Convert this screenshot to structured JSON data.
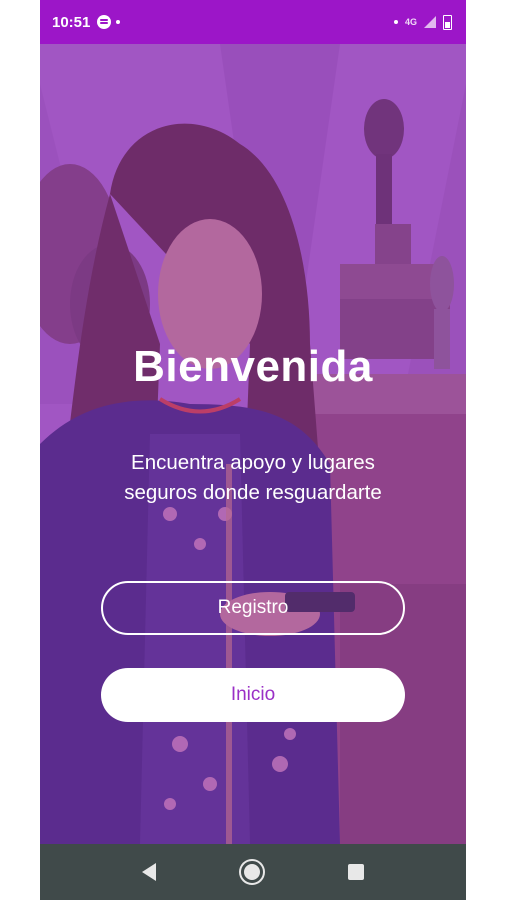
{
  "status_bar": {
    "time": "10:51",
    "network": "4G",
    "icons": [
      "spotify-icon",
      "notification-dot-icon",
      "signal-icon",
      "battery-icon"
    ]
  },
  "welcome": {
    "title": "Bienvenida",
    "subtitle_line1": "Encuentra apoyo y lugares",
    "subtitle_line2": "seguros donde resguardarte"
  },
  "buttons": {
    "register_label": "Registro",
    "login_label": "Inicio"
  },
  "navigation": {
    "icons": [
      "back-icon",
      "home-icon",
      "recents-icon"
    ]
  },
  "colors": {
    "status_bar": "#9c16c8",
    "accent": "#9a2fc6",
    "nav_bar": "#404a4a"
  }
}
